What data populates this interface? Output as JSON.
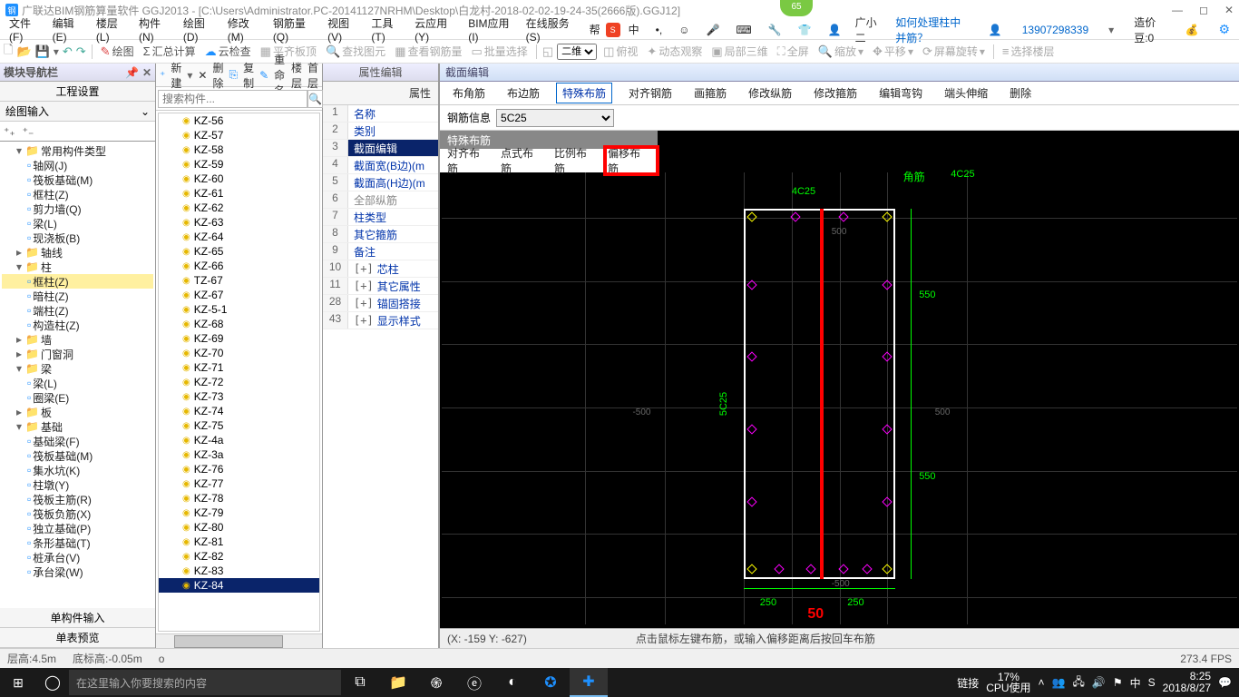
{
  "title": "广联达BIM钢筋算量软件 GGJ2013 - [C:\\Users\\Administrator.PC-20141127NRHM\\Desktop\\白龙村-2018-02-02-19-24-35(2666版).GGJ12]",
  "badge": "65",
  "menu": [
    "文件(F)",
    "编辑(E)",
    "楼层(L)",
    "构件(N)",
    "绘图(D)",
    "修改(M)",
    "钢筋量(Q)",
    "视图(V)",
    "工具(T)",
    "云应用(Y)",
    "BIM应用(I)",
    "在线服务(S)",
    "帮"
  ],
  "help_link": "如何处理柱中并筋？",
  "user_name": "广小二",
  "phone": "13907298339",
  "coin": "造价豆:0",
  "tool1": {
    "绘图": "绘图",
    "汇总": "汇总计算",
    "云检": "云检查",
    "平齐": "平齐板顶",
    "查找": "查找图元",
    "查看": "查看钢筋量",
    "批量": "批量选择",
    "二维": "二维",
    "俯视": "俯视",
    "动态": "动态观察",
    "局部": "局部三维",
    "全屏": "全屏",
    "缩放": "缩放",
    "平移": "平移",
    "屏旋": "屏幕旋转",
    "选楼": "选择楼层"
  },
  "navtitle": "模块导航栏",
  "btn1": "工程设置",
  "btn2": "绘图输入",
  "tree": [
    {
      "l": 0,
      "e": "▾",
      "t": "常用构件类型",
      "f": 1
    },
    {
      "l": 1,
      "t": "轴网(J)",
      "c": "tl"
    },
    {
      "l": 1,
      "t": "筏板基础(M)",
      "c": "tl"
    },
    {
      "l": 1,
      "t": "框柱(Z)",
      "c": "tl"
    },
    {
      "l": 1,
      "t": "剪力墙(Q)",
      "c": "tl"
    },
    {
      "l": 1,
      "t": "梁(L)",
      "c": "tl"
    },
    {
      "l": 1,
      "t": "现浇板(B)",
      "c": "tl"
    },
    {
      "l": 0,
      "e": "▸",
      "t": "轴线",
      "f": 1
    },
    {
      "l": 0,
      "e": "▾",
      "t": "柱",
      "f": 1
    },
    {
      "l": 1,
      "t": "框柱(Z)",
      "c": "tl",
      "hl": 1
    },
    {
      "l": 1,
      "t": "暗柱(Z)",
      "c": "tl"
    },
    {
      "l": 1,
      "t": "端柱(Z)",
      "c": "tl"
    },
    {
      "l": 1,
      "t": "构造柱(Z)",
      "c": "tl"
    },
    {
      "l": 0,
      "e": "▸",
      "t": "墙",
      "f": 1
    },
    {
      "l": 0,
      "e": "▸",
      "t": "门窗洞",
      "f": 1
    },
    {
      "l": 0,
      "e": "▾",
      "t": "梁",
      "f": 1
    },
    {
      "l": 1,
      "t": "梁(L)",
      "c": "tl"
    },
    {
      "l": 1,
      "t": "圈梁(E)",
      "c": "tl"
    },
    {
      "l": 0,
      "e": "▸",
      "t": "板",
      "f": 1
    },
    {
      "l": 0,
      "e": "▾",
      "t": "基础",
      "f": 1
    },
    {
      "l": 1,
      "t": "基础梁(F)",
      "c": "tl"
    },
    {
      "l": 1,
      "t": "筏板基础(M)",
      "c": "tl"
    },
    {
      "l": 1,
      "t": "集水坑(K)",
      "c": "tl"
    },
    {
      "l": 1,
      "t": "柱墩(Y)",
      "c": "tl"
    },
    {
      "l": 1,
      "t": "筏板主筋(R)",
      "c": "tl"
    },
    {
      "l": 1,
      "t": "筏板负筋(X)",
      "c": "tl"
    },
    {
      "l": 1,
      "t": "独立基础(P)",
      "c": "tl"
    },
    {
      "l": 1,
      "t": "条形基础(T)",
      "c": "tl"
    },
    {
      "l": 1,
      "t": "桩承台(V)",
      "c": "tl"
    },
    {
      "l": 1,
      "t": "承台梁(W)",
      "c": "tl"
    }
  ],
  "btn3": "单构件输入",
  "btn4": "单表预览",
  "mid_tbar": [
    "新建",
    "删除",
    "复制",
    "重命名",
    "楼层",
    "首层"
  ],
  "search_ph": "搜索构件...",
  "kzlist": [
    "KZ-56",
    "KZ-57",
    "KZ-58",
    "KZ-59",
    "KZ-60",
    "KZ-61",
    "KZ-62",
    "KZ-63",
    "KZ-64",
    "KZ-65",
    "KZ-66",
    "TZ-67",
    "KZ-67",
    "KZ-5-1",
    "KZ-68",
    "KZ-69",
    "KZ-70",
    "KZ-71",
    "KZ-72",
    "KZ-73",
    "KZ-74",
    "KZ-75",
    "KZ-4a",
    "KZ-3a",
    "KZ-76",
    "KZ-77",
    "KZ-78",
    "KZ-79",
    "KZ-80",
    "KZ-81",
    "KZ-82",
    "KZ-83",
    "KZ-84"
  ],
  "kz_sel": "KZ-84",
  "prop_title": "属性编辑",
  "prop_col": "属性",
  "props": [
    {
      "n": "1",
      "v": "名称"
    },
    {
      "n": "2",
      "v": "类别"
    },
    {
      "n": "3",
      "v": "截面编辑",
      "sel": 1
    },
    {
      "n": "4",
      "v": "截面宽(B边)(m"
    },
    {
      "n": "5",
      "v": "截面高(H边)(m"
    },
    {
      "n": "6",
      "v": "全部纵筋",
      "g": 1
    },
    {
      "n": "7",
      "v": "柱类型"
    },
    {
      "n": "8",
      "v": "其它箍筋"
    },
    {
      "n": "9",
      "v": "备注"
    },
    {
      "n": "10",
      "v": "芯柱",
      "pm": "+"
    },
    {
      "n": "11",
      "v": "其它属性",
      "pm": "+"
    },
    {
      "n": "28",
      "v": "锚固搭接",
      "pm": "+"
    },
    {
      "n": "43",
      "v": "显示样式",
      "pm": "+"
    }
  ],
  "canvas_title": "截面编辑",
  "ctabs": [
    "布角筋",
    "布边筋",
    "特殊布筋",
    "对齐钢筋",
    "画箍筋",
    "修改纵筋",
    "修改箍筋",
    "编辑弯钩",
    "端头伸缩",
    "删除"
  ],
  "ctab_act": "特殊布筋",
  "info_lbl": "钢筋信息",
  "info_val": "5C25",
  "sub_title": "特殊布筋",
  "subtabs": [
    "对齐布筋",
    "点式布筋",
    "比例布筋",
    "偏移布筋"
  ],
  "corner": "角筋",
  "corner_v": "4C25",
  "dim_top": "4C25",
  "dim_side": "550",
  "dim_side2": "550",
  "dim_b1": "250",
  "dim_b2": "250",
  "side_lbl": "5C25",
  "g500l": "-500",
  "g500r": "500",
  "g500t": "500",
  "g500b": "-500",
  "red50": "50",
  "coords": "(X: -159 Y: -627)",
  "hint": "点击鼠标左键布筋，或输入偏移距离后按回车布筋",
  "stat_l": "层高:4.5m",
  "stat_m": "底标高:-0.05m",
  "stat_o": "o",
  "fps": "273.4 FPS",
  "task_srch": "在这里输入你要搜索的内容",
  "tray_link": "链接",
  "cpu_p": "17%",
  "cpu_l": "CPU使用",
  "time": "8:25",
  "date": "2018/8/27"
}
